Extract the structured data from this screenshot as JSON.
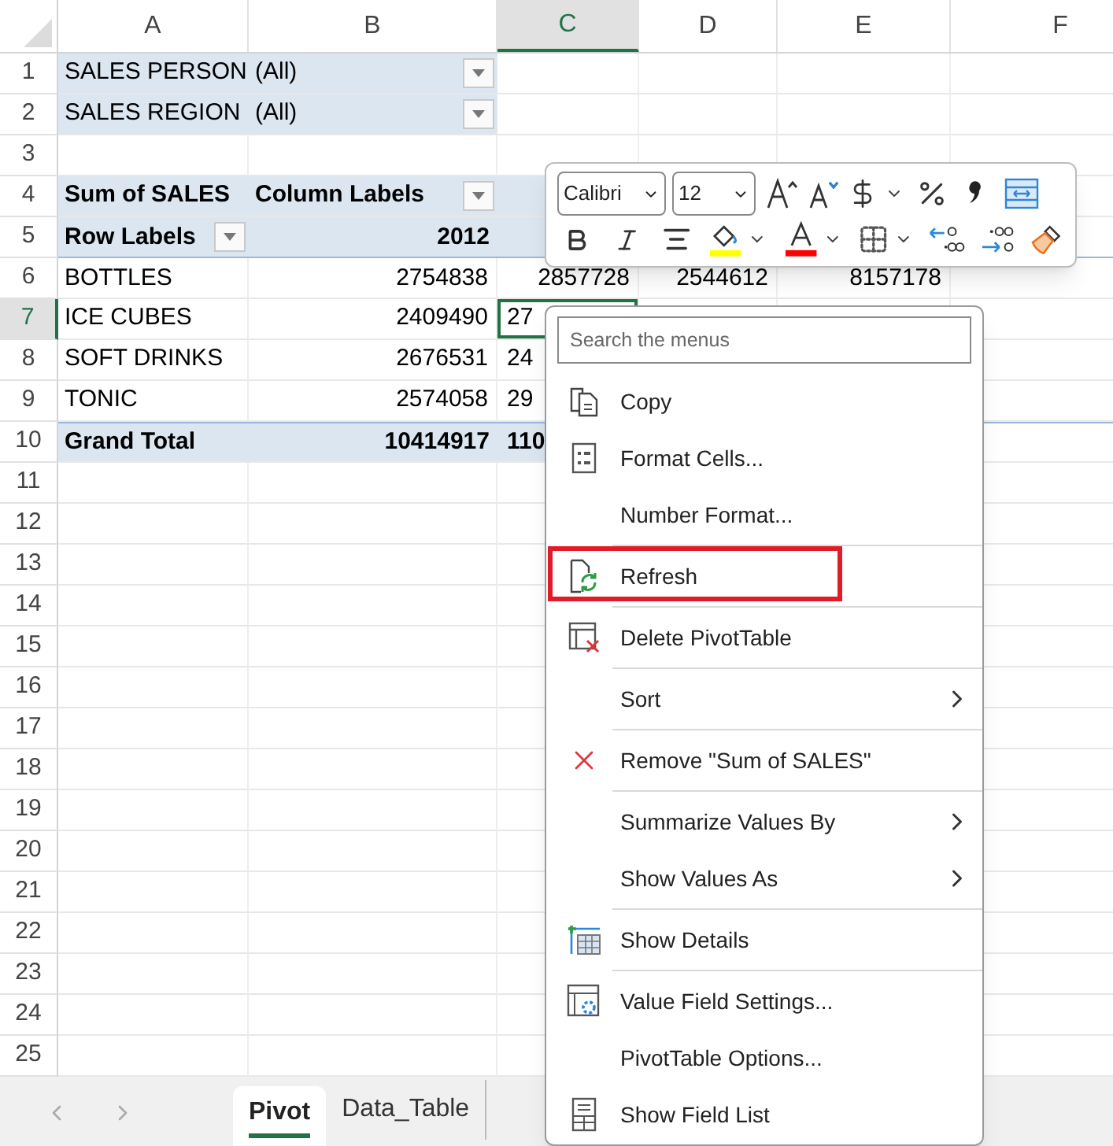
{
  "columns": [
    {
      "label": "A",
      "selected": false
    },
    {
      "label": "B",
      "selected": false
    },
    {
      "label": "C",
      "selected": true
    },
    {
      "label": "D",
      "selected": false
    },
    {
      "label": "E",
      "selected": false
    },
    {
      "label": "F",
      "selected": false
    }
  ],
  "rows": [
    {
      "number": "1",
      "selected": false,
      "kind": "filter",
      "cells": [
        {
          "text": "SALES PERSON",
          "bold": false,
          "kind": "text"
        },
        {
          "text": "(All)",
          "bold": false,
          "kind": "text",
          "dropdown": true
        }
      ]
    },
    {
      "number": "2",
      "selected": false,
      "kind": "filter",
      "cells": [
        {
          "text": "SALES REGION",
          "bold": false,
          "kind": "text"
        },
        {
          "text": "(All)",
          "bold": false,
          "kind": "text",
          "dropdown": true
        }
      ]
    },
    {
      "number": "3",
      "selected": false,
      "cells": []
    },
    {
      "number": "4",
      "selected": false,
      "kind": "header",
      "cells": [
        {
          "text": "Sum of SALES",
          "bold": true,
          "kind": "text"
        },
        {
          "text": "Column Labels",
          "bold": true,
          "kind": "text",
          "dropdown": true
        }
      ]
    },
    {
      "number": "5",
      "selected": false,
      "kind": "header",
      "cells": [
        {
          "text": "Row Labels",
          "bold": true,
          "kind": "text",
          "dropdown": true
        },
        {
          "text": "2012",
          "bold": true,
          "kind": "number"
        }
      ]
    },
    {
      "number": "6",
      "selected": false,
      "cells": [
        {
          "text": "BOTTLES",
          "bold": false,
          "kind": "text"
        },
        {
          "text": "2754838",
          "bold": false,
          "kind": "number"
        },
        {
          "text": "2857728",
          "bold": false,
          "kind": "number"
        },
        {
          "text": "2544612",
          "bold": false,
          "kind": "number"
        },
        {
          "text": "8157178",
          "bold": false,
          "kind": "number"
        }
      ]
    },
    {
      "number": "7",
      "selected": true,
      "cells": [
        {
          "text": "ICE CUBES",
          "bold": false,
          "kind": "text"
        },
        {
          "text": "2409490",
          "bold": false,
          "kind": "number"
        },
        {
          "text": "27",
          "bold": false,
          "kind": "cut"
        }
      ]
    },
    {
      "number": "8",
      "selected": false,
      "cells": [
        {
          "text": "SOFT DRINKS",
          "bold": false,
          "kind": "text"
        },
        {
          "text": "2676531",
          "bold": false,
          "kind": "number"
        },
        {
          "text": "24",
          "bold": false,
          "kind": "cut"
        }
      ]
    },
    {
      "number": "9",
      "selected": false,
      "cells": [
        {
          "text": "TONIC",
          "bold": false,
          "kind": "text"
        },
        {
          "text": "2574058",
          "bold": false,
          "kind": "number"
        },
        {
          "text": "29",
          "bold": false,
          "kind": "cut"
        }
      ]
    },
    {
      "number": "10",
      "selected": false,
      "kind": "total",
      "cells": [
        {
          "text": "Grand Total",
          "bold": true,
          "kind": "text"
        },
        {
          "text": "10414917",
          "bold": true,
          "kind": "number"
        },
        {
          "text": "110",
          "bold": true,
          "kind": "cut"
        }
      ]
    },
    {
      "number": "11",
      "selected": false,
      "cells": []
    },
    {
      "number": "12",
      "selected": false,
      "cells": []
    },
    {
      "number": "13",
      "selected": false,
      "cells": []
    },
    {
      "number": "14",
      "selected": false,
      "cells": []
    },
    {
      "number": "15",
      "selected": false,
      "cells": []
    },
    {
      "number": "16",
      "selected": false,
      "cells": []
    },
    {
      "number": "17",
      "selected": false,
      "cells": []
    },
    {
      "number": "18",
      "selected": false,
      "cells": []
    },
    {
      "number": "19",
      "selected": false,
      "cells": []
    },
    {
      "number": "20",
      "selected": false,
      "cells": []
    },
    {
      "number": "21",
      "selected": false,
      "cells": []
    },
    {
      "number": "22",
      "selected": false,
      "cells": []
    },
    {
      "number": "23",
      "selected": false,
      "cells": []
    },
    {
      "number": "24",
      "selected": false,
      "cells": []
    },
    {
      "number": "25",
      "selected": false,
      "cells": []
    }
  ],
  "mini_toolbar": {
    "font": "Calibri",
    "size": "12"
  },
  "context_menu": {
    "search": {
      "placeholder": "Search the menus"
    },
    "items": [
      {
        "label": "Copy",
        "kind": "command",
        "separator_before": false,
        "highlighted": false
      },
      {
        "label": "Format Cells...",
        "kind": "command",
        "separator_before": false,
        "highlighted": false
      },
      {
        "label": "Number Format...",
        "kind": "command",
        "separator_before": false,
        "highlighted": false
      },
      {
        "label": "Refresh",
        "kind": "command",
        "separator_before": true,
        "highlighted": true
      },
      {
        "label": "Delete PivotTable",
        "kind": "command",
        "separator_before": true,
        "highlighted": false
      },
      {
        "label": "Sort",
        "kind": "submenu",
        "separator_before": true,
        "highlighted": false
      },
      {
        "label": "Remove \"Sum of SALES\"",
        "kind": "command",
        "separator_before": true,
        "highlighted": false
      },
      {
        "label": "Summarize Values By",
        "kind": "submenu",
        "separator_before": true,
        "highlighted": false
      },
      {
        "label": "Show Values As",
        "kind": "submenu",
        "separator_before": false,
        "highlighted": false
      },
      {
        "label": "Show Details",
        "kind": "command",
        "separator_before": true,
        "highlighted": false
      },
      {
        "label": "Value Field Settings...",
        "kind": "command",
        "separator_before": true,
        "highlighted": false
      },
      {
        "label": "PivotTable Options...",
        "kind": "command",
        "separator_before": false,
        "highlighted": false
      },
      {
        "label": "Show Field List",
        "kind": "command",
        "separator_before": false,
        "highlighted": false
      }
    ]
  },
  "sheet_tabs": [
    {
      "label": "Pivot",
      "selected": true
    },
    {
      "label": "Data_Table",
      "selected": false
    }
  ]
}
